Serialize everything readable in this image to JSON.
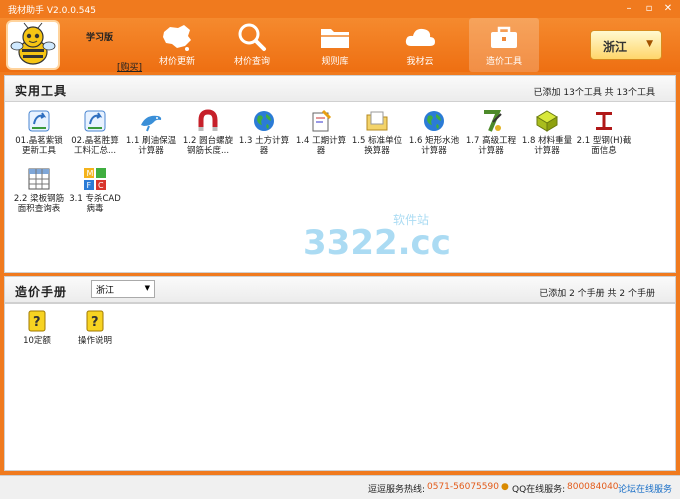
{
  "window": {
    "title": "我材助手 V2.0.0.545"
  },
  "header": {
    "edition": "学习版",
    "buy": "[购买]",
    "nav": [
      {
        "label": "材价更新",
        "icon": "china-map-icon"
      },
      {
        "label": "材价查询",
        "icon": "magnifier-icon"
      },
      {
        "label": "规则库",
        "icon": "folder-icon"
      },
      {
        "label": "我材云",
        "icon": "cloud-icon"
      },
      {
        "label": "造价工具",
        "icon": "toolbox-icon"
      }
    ],
    "region": "浙江"
  },
  "tools_section": {
    "title": "实用工具",
    "count": "已添加 13个工具   共 13个工具",
    "items": [
      {
        "label": "01.晶茗紫锁更新工具"
      },
      {
        "label": "02.晶茗胜算工料汇总..."
      },
      {
        "label": "1.1 刷油保温计算器"
      },
      {
        "label": "1.2 圆台螺旋钢筋长度..."
      },
      {
        "label": "1.3 土方计算器"
      },
      {
        "label": "1.4 工期计算器"
      },
      {
        "label": "1.5 标准单位换算器"
      },
      {
        "label": "1.6 矩形水池计算器"
      },
      {
        "label": "1.7 高级工程计算器"
      },
      {
        "label": "1.8 材料重量计算器"
      },
      {
        "label": "2.1 型钢(H)截面信息"
      },
      {
        "label": "2.2 梁板钢筋面积查询表"
      },
      {
        "label": "3.1 专杀CAD病毒"
      }
    ]
  },
  "manual_section": {
    "title": "造价手册",
    "select": "浙江",
    "count": "已添加 2 个手册   共 2 个手册",
    "items": [
      {
        "label": "10定额"
      },
      {
        "label": "操作说明"
      }
    ]
  },
  "watermark": {
    "main": "3322.cc",
    "sub": "软件站"
  },
  "status": {
    "hotline_label": "逗逗服务热线:",
    "hotline": "0571-56075590",
    "qq_label": "QQ在线服务:",
    "qq": "800084040",
    "forum": "论坛在线服务"
  }
}
